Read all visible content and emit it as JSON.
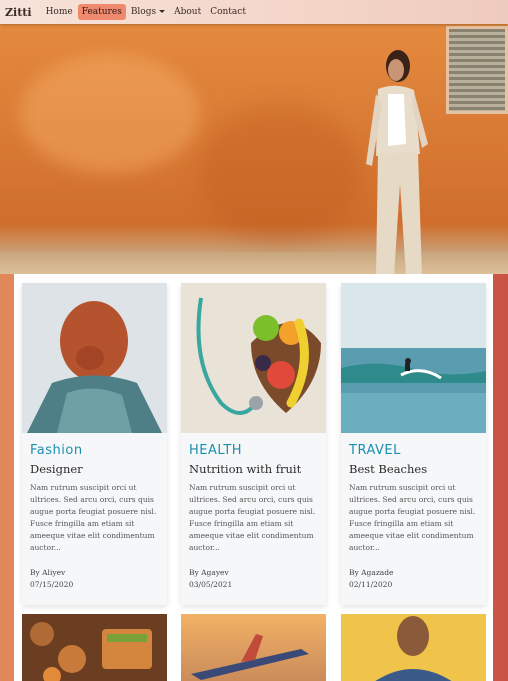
{
  "nav": {
    "brand": "Zitti",
    "items": [
      {
        "label": "Home"
      },
      {
        "label": "Features"
      },
      {
        "label": "Blogs"
      },
      {
        "label": "About"
      },
      {
        "label": "Contact"
      }
    ]
  },
  "cards": [
    {
      "category": "Fashion",
      "title": "Designer",
      "excerpt": "Nam rutrum suscipit orci ut ultrices. Sed arcu orci, curs quis augue porta feugiat posuere nisl. Fusce fringilla am etiam sit ameeque vitae elit condimentum auctor...",
      "author": "By Aliyev",
      "date": "07/15/2020"
    },
    {
      "category": "HEALTH",
      "title": "Nutrition with fruit",
      "excerpt": "Nam rutrum suscipit orci ut ultrices. Sed arcu orci, curs quis augue porta feugiat posuere nisl. Fusce fringilla am etiam sit ameeque vitae elit condimentum auctor...",
      "author": "By Agayev",
      "date": "03/05/2021"
    },
    {
      "category": "TRAVEL",
      "title": "Best Beaches",
      "excerpt": "Nam rutrum suscipit orci ut ultrices. Sed arcu orci, curs quis augue porta feugiat posuere nisl. Fusce fringilla am etiam sit ameeque vitae elit condimentum auctor...",
      "author": "By Agazade",
      "date": "02/11/2020"
    }
  ],
  "colors": {
    "accent": "#1a8fb0",
    "nav_active": "#f08a6e"
  }
}
